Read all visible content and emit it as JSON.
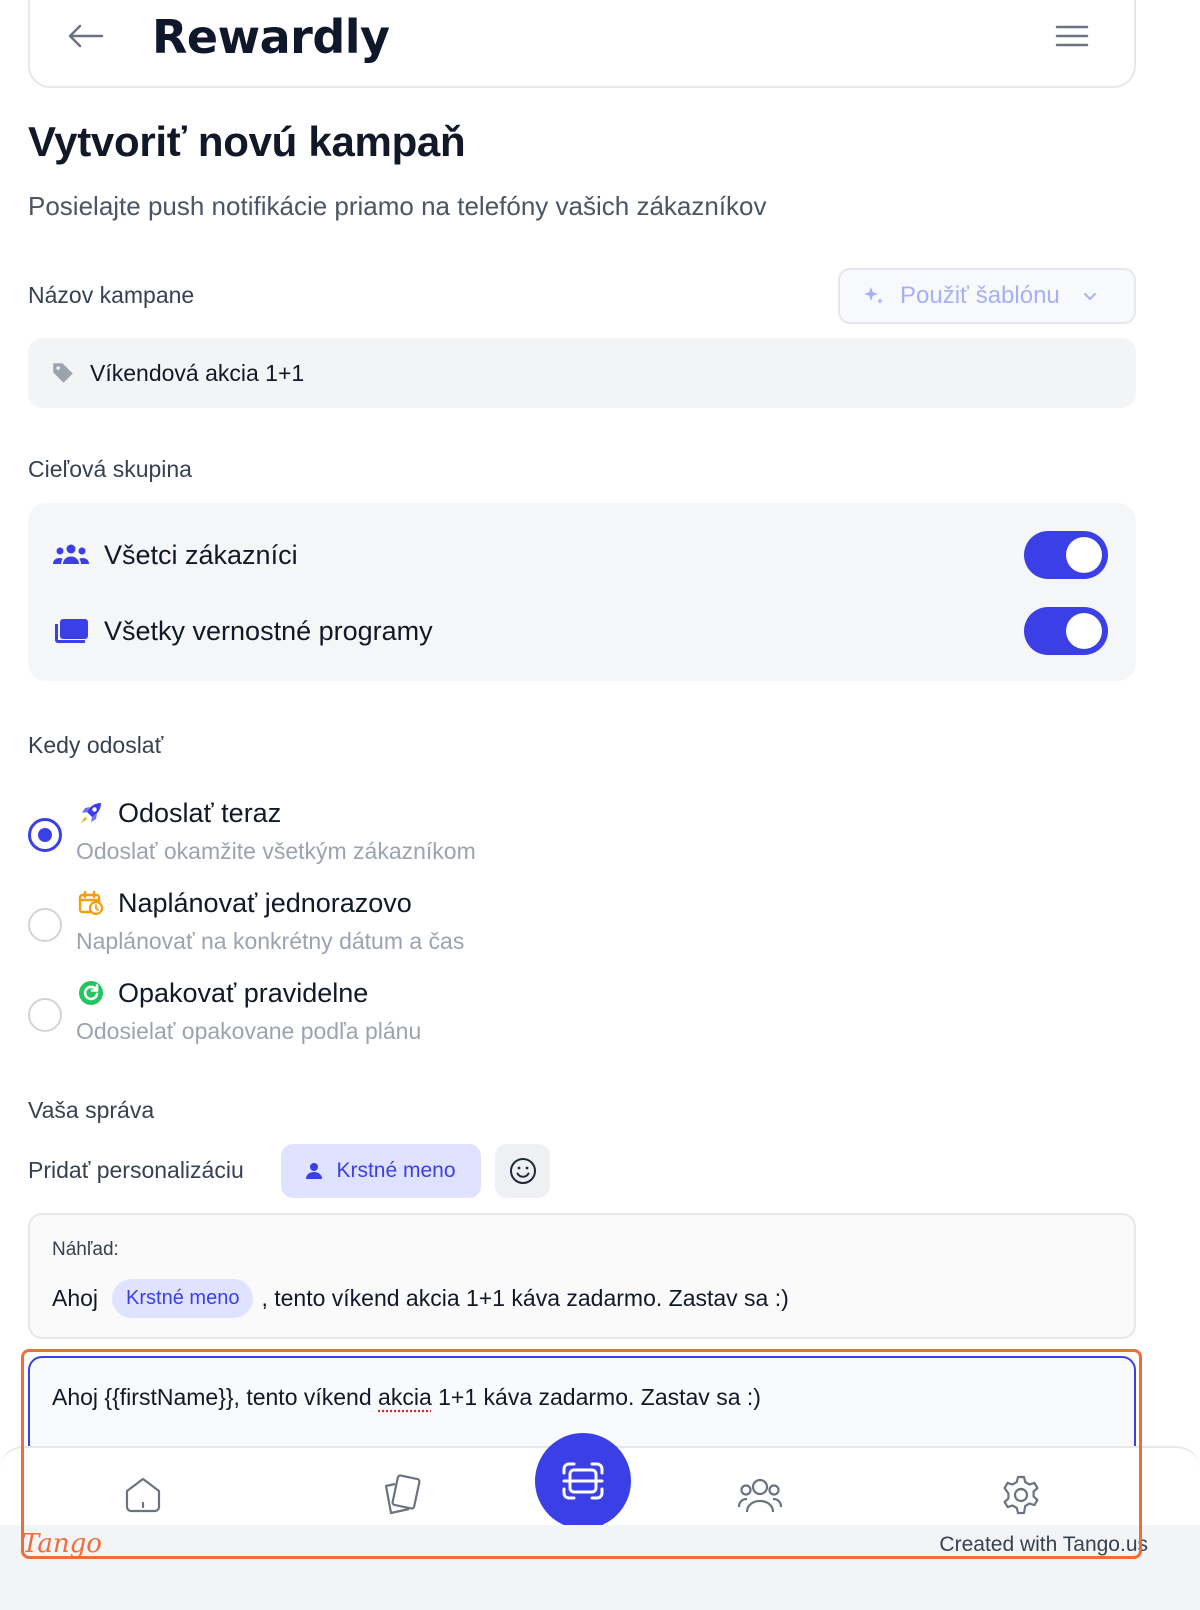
{
  "header": {
    "logo_text": "Rewardly",
    "back_icon": "arrow-left-icon",
    "menu_icon": "hamburger-menu-icon"
  },
  "page": {
    "title": "Vytvoriť novú kampaň",
    "subtitle": "Posielajte push notifikácie priamo na telefóny vašich zákazníkov"
  },
  "campaign_name": {
    "label": "Názov kampane",
    "template_button": "Použiť šablónu",
    "value": "Víkendová akcia 1+1",
    "icon": "tag-icon"
  },
  "target_group": {
    "label": "Cieľová skupina",
    "options": [
      {
        "label": "Všetci zákazníci",
        "icon": "users-icon",
        "enabled": true
      },
      {
        "label": "Všetky vernostné programy",
        "icon": "cards-icon",
        "enabled": true
      }
    ]
  },
  "schedule": {
    "label": "Kedy odoslať",
    "options": [
      {
        "title": "Odoslať teraz",
        "description": "Odoslať okamžite všetkým zákazníkom",
        "icon": "rocket-icon",
        "selected": true
      },
      {
        "title": "Naplánovať jednorazovo",
        "description": "Naplánovať na konkrétny dátum a čas",
        "icon": "calendar-clock-icon",
        "selected": false
      },
      {
        "title": "Opakovať pravidelne",
        "description": "Odosielať opakovane podľa plánu",
        "icon": "repeat-icon",
        "selected": false
      }
    ]
  },
  "message": {
    "label": "Vaša správa",
    "personalization_label": "Pridať personalizáciu",
    "first_name_chip": "Krstné meno",
    "preview_label": "Náhľad:",
    "preview_before": "Ahoj",
    "preview_chip": "Krstné meno",
    "preview_after": ", tento víkend akcia 1+1 káva zadarmo. Zastav sa :)",
    "input_before": "Ahoj {{firstName}}, tento víkend ",
    "input_misspelled": "akcia",
    "input_after": " 1+1 káva zadarmo. Zastav sa :)"
  },
  "bottom_nav": {
    "items": [
      "home-icon",
      "cards-icon",
      "scan-icon",
      "customers-icon",
      "settings-icon"
    ]
  },
  "footer": {
    "brand": "Tango",
    "credit": "Created with Tango.us"
  },
  "colors": {
    "accent": "#3b3fe6",
    "accent_light": "#e0e3ff",
    "highlight": "#f26b3a"
  }
}
